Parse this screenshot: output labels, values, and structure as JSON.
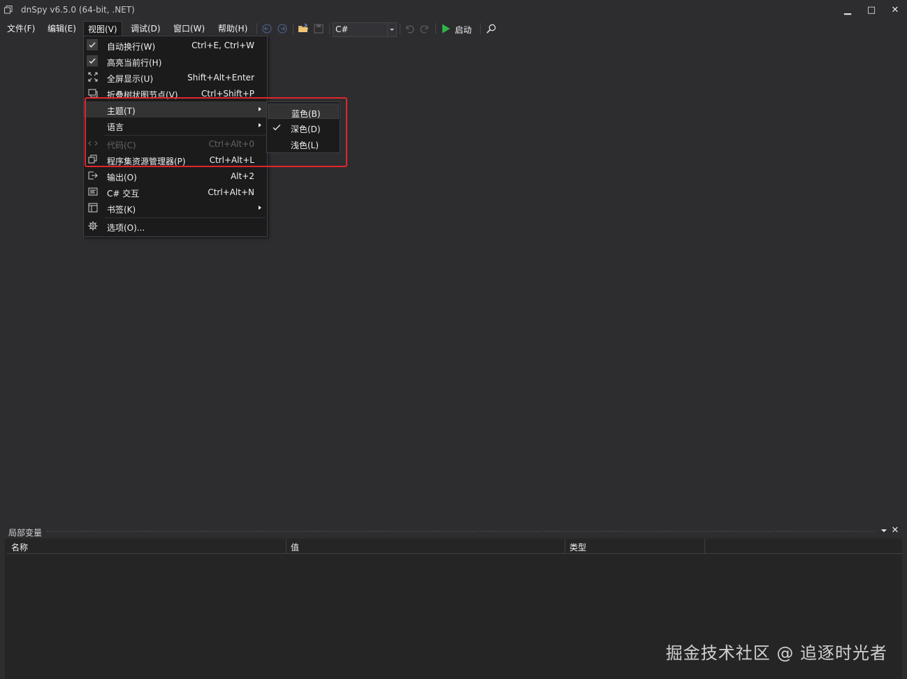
{
  "window": {
    "title": "dnSpy v6.5.0 (64-bit, .NET)",
    "minimize_glyph": "▁",
    "maximize_glyph": "□",
    "close_glyph": "✕"
  },
  "menubar": {
    "file": "文件(F)",
    "edit": "编辑(E)",
    "view": "视图(V)",
    "debug": "调试(D)",
    "window": "窗口(W)",
    "help": "帮助(H)"
  },
  "toolbar": {
    "language": "C#",
    "run_label": "启动",
    "icons": [
      "back-icon",
      "forward-icon",
      "open-folder-icon",
      "save-icon",
      "undo-icon",
      "redo-icon",
      "play-icon",
      "search-icon"
    ],
    "run_color": "#2fb54a"
  },
  "view_menu": {
    "items": [
      {
        "label": "自动换行(W)",
        "shortcut": "Ctrl+E, Ctrl+W",
        "checked": true
      },
      {
        "label": "高亮当前行(H)",
        "shortcut": "",
        "checked": true
      },
      {
        "label": "全屏显示(U)",
        "shortcut": "Shift+Alt+Enter",
        "icon": "fullscreen-icon"
      },
      {
        "label": "折叠树状图节点(V)",
        "shortcut": "Ctrl+Shift+P",
        "icon": "collapse-tree-icon"
      },
      {
        "label": "主题(T)",
        "submenu": true
      },
      {
        "label": "语言",
        "submenu": true
      },
      {
        "label": "代码(C)",
        "shortcut": "Ctrl+Alt+0",
        "disabled": true,
        "icon": "code-icon"
      },
      {
        "label": "程序集资源管理器(P)",
        "shortcut": "Ctrl+Alt+L",
        "icon": "assembly-explorer-icon"
      },
      {
        "label": "输出(O)",
        "shortcut": "Alt+2",
        "icon": "output-icon"
      },
      {
        "label": "C# 交互",
        "shortcut": "Ctrl+Alt+N",
        "icon": "csharp-interactive-icon"
      },
      {
        "label": "书签(K)",
        "submenu": true,
        "icon": "bookmark-icon"
      },
      {
        "label": "选项(O)...",
        "icon": "gear-icon"
      }
    ]
  },
  "theme_submenu": {
    "items": [
      {
        "label": "蓝色(B)",
        "checked": false
      },
      {
        "label": "深色(D)",
        "checked": true
      },
      {
        "label": "浅色(L)",
        "checked": false
      }
    ]
  },
  "annotation": {
    "color": "#e0262a"
  },
  "locals_panel": {
    "title": "局部变量",
    "columns": [
      "名称",
      "值",
      "类型"
    ],
    "close_glyph": "✕"
  },
  "watermark": "掘金技术社区 @ 追逐时光者"
}
